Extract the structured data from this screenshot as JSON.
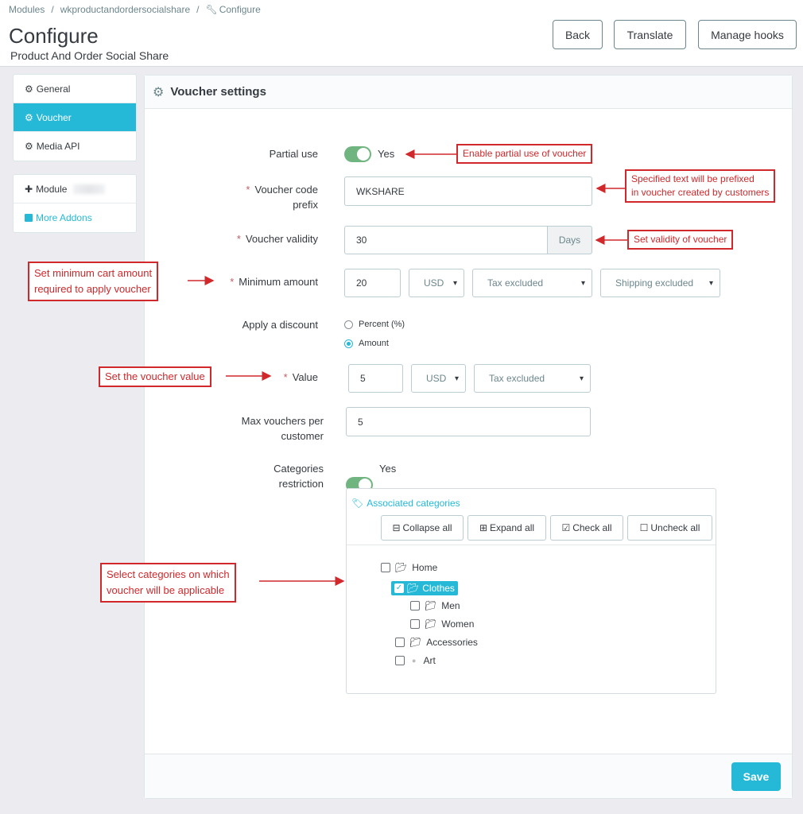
{
  "breadcrumb": [
    "Modules",
    "wkproductandordersocialshare",
    "Configure"
  ],
  "header": {
    "title": "Configure",
    "subtitle": "Product And Order Social Share",
    "buttons": {
      "back": "Back",
      "translate": "Translate",
      "manage_hooks": "Manage hooks"
    }
  },
  "sidebar": {
    "items": [
      {
        "label": "General",
        "icon": "gear-icon"
      },
      {
        "label": "Voucher",
        "icon": "gear-icon"
      },
      {
        "label": "Media API",
        "icon": "gear-icon"
      }
    ],
    "module_label": "Module",
    "more_addons": "More Addons"
  },
  "panel": {
    "title": "Voucher settings",
    "save": "Save"
  },
  "form": {
    "partial_use": {
      "label": "Partial use",
      "value": "Yes"
    },
    "prefix": {
      "label": "Voucher code prefix",
      "value": "WKSHARE"
    },
    "validity": {
      "label": "Voucher validity",
      "value": "30",
      "unit": "Days"
    },
    "min_amount": {
      "label": "Minimum amount",
      "value": "20",
      "currency": "USD",
      "tax": "Tax excluded",
      "shipping": "Shipping excluded"
    },
    "apply_discount": {
      "label": "Apply a discount",
      "options": [
        "Percent (%)",
        "Amount"
      ],
      "selected": "Amount"
    },
    "value": {
      "label": "Value",
      "value": "5",
      "currency": "USD",
      "tax": "Tax excluded"
    },
    "max_vouchers": {
      "label": "Max vouchers per customer",
      "value": "5"
    },
    "categories": {
      "label": "Categories restriction",
      "value": "Yes"
    }
  },
  "tree": {
    "title": "Associated categories",
    "buttons": {
      "collapse": "Collapse all",
      "expand": "Expand all",
      "check": "Check all",
      "uncheck": "Uncheck all"
    },
    "nodes": {
      "home": "Home",
      "clothes": "Clothes",
      "men": "Men",
      "women": "Women",
      "accessories": "Accessories",
      "art": "Art"
    }
  },
  "annotations": {
    "partial": "Enable partial use of voucher",
    "prefix_1": "Specified text will be prefixed",
    "prefix_2": "in voucher created by customers",
    "validity": "Set validity of voucher",
    "min_1": "Set minimum cart amount",
    "min_2": "required to apply voucher",
    "value": "Set the voucher value",
    "cat_1": "Select categories on which",
    "cat_2": "voucher will be applicable"
  },
  "colors": {
    "accent": "#25b9d7",
    "toggle_on": "#70b580",
    "annotation": "#d0282b"
  }
}
